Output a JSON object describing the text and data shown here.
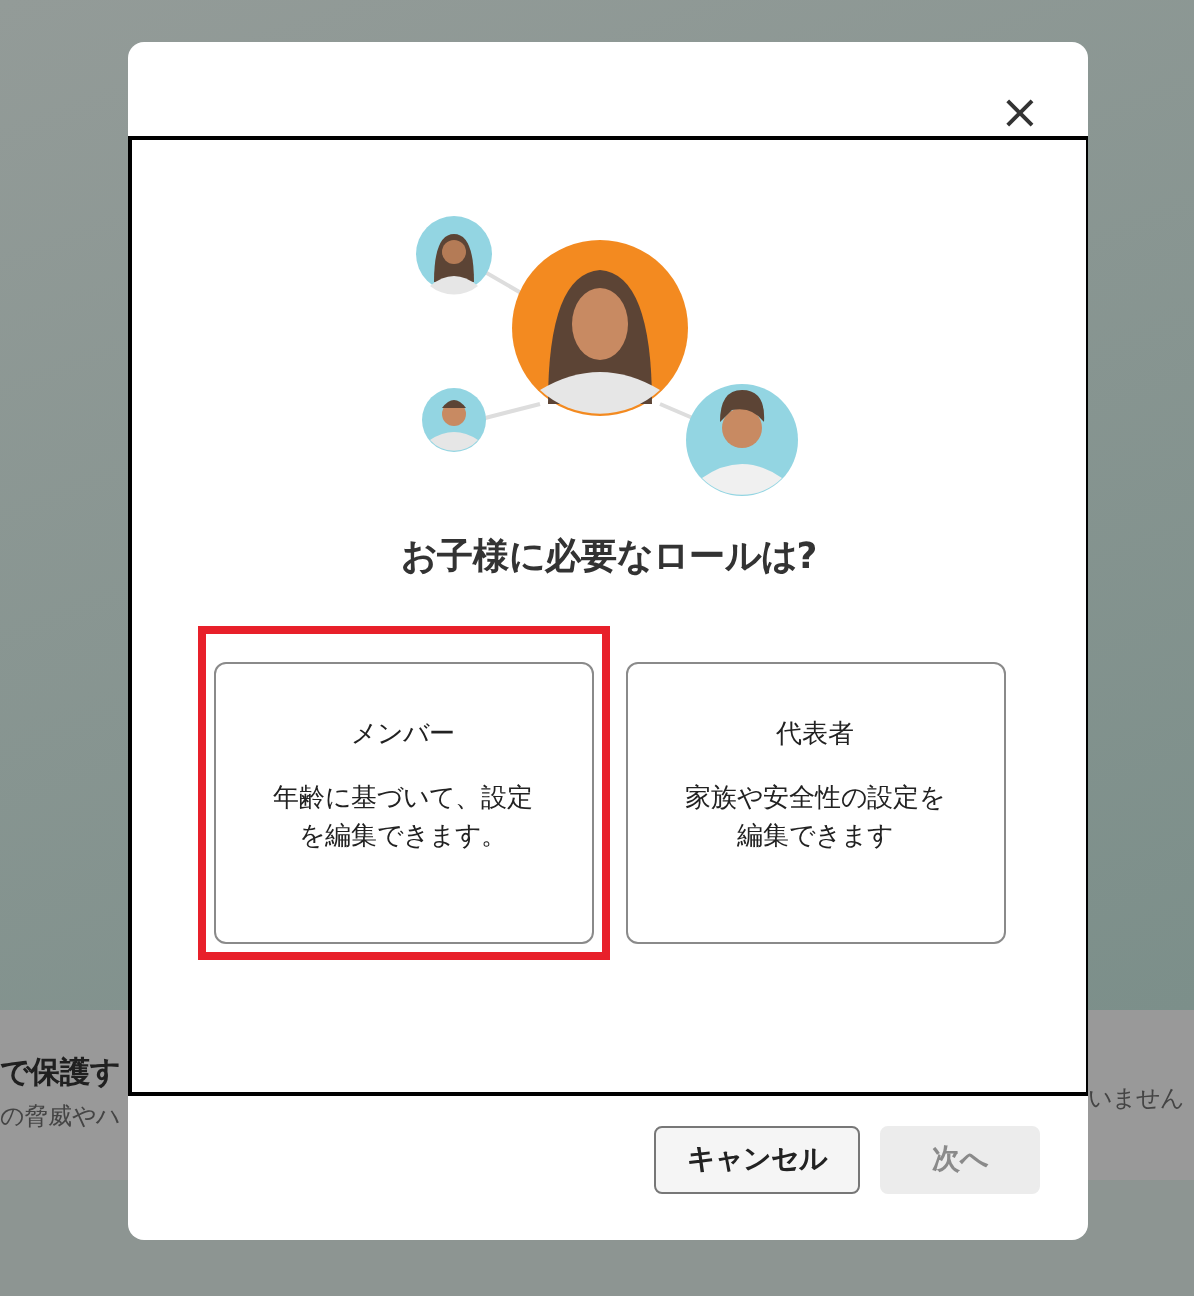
{
  "background": {
    "left_heading": "で保護す",
    "left_text": "の脅威やハ",
    "right_text": "いません"
  },
  "dialog": {
    "close": "×",
    "title": "お子様に必要なロールは?",
    "roles": [
      {
        "name": "メンバー",
        "description": "年齢に基づいて、設定を編集できます。",
        "selected": true
      },
      {
        "name": "代表者",
        "description": "家族や安全性の設定を編集できます",
        "selected": false
      }
    ],
    "buttons": [
      {
        "label": "キャンセル",
        "disabled": false
      },
      {
        "label": "次へ",
        "disabled": true
      }
    ]
  }
}
